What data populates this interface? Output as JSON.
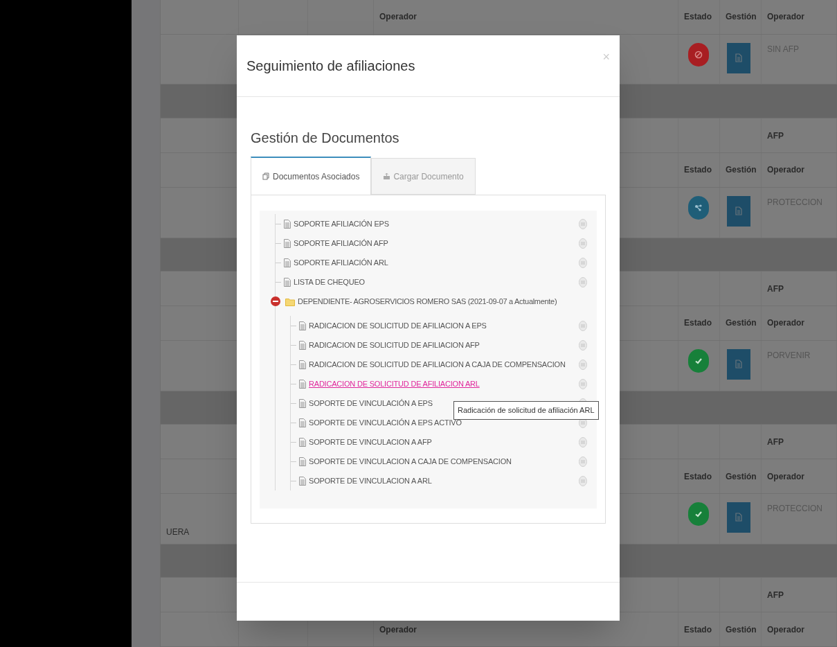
{
  "background_table": {
    "rows": [
      {
        "kind": "header",
        "middle_label": "Operador",
        "columns": [
          "Estado",
          "Gestión",
          "Operador"
        ]
      },
      {
        "kind": "data",
        "status": {
          "kind": "blocked",
          "color": "#a81e22"
        },
        "operator": "SIN AFP"
      },
      {
        "kind": "band"
      },
      {
        "kind": "type",
        "label": "AFP"
      },
      {
        "kind": "header",
        "columns": [
          "Estado",
          "Gestión",
          "Operador"
        ]
      },
      {
        "kind": "data",
        "status": {
          "kind": "network",
          "color": "#1f5e78"
        },
        "operator": "PROTECCION"
      },
      {
        "kind": "band"
      },
      {
        "kind": "type",
        "label": "AFP"
      },
      {
        "kind": "header",
        "columns": [
          "Estado",
          "Gestión",
          "Operador"
        ]
      },
      {
        "kind": "data",
        "status": {
          "kind": "check",
          "color": "#17803a"
        },
        "operator": "PORVENIR"
      },
      {
        "kind": "band"
      },
      {
        "kind": "type",
        "label": "AFP"
      },
      {
        "kind": "header",
        "columns": [
          "Estado",
          "Gestión",
          "Operador"
        ]
      },
      {
        "kind": "data",
        "status": {
          "kind": "check",
          "color": "#17803a"
        },
        "operator": "PROTECCION",
        "left_text": "UERA"
      },
      {
        "kind": "band"
      },
      {
        "kind": "type",
        "label": "AFP"
      },
      {
        "kind": "header",
        "middle_label": "Operador",
        "columns": [
          "Estado",
          "Gestión",
          "Operador"
        ]
      }
    ]
  },
  "modal": {
    "title": "Seguimiento de afiliaciones",
    "close": "×",
    "heading": "Gestión de Documentos",
    "tabs": [
      {
        "label": "Documentos Asociados",
        "selected": true
      },
      {
        "label": "Cargar Documento",
        "selected": false
      }
    ],
    "tree": [
      {
        "kind": "file",
        "label": "SOPORTE AFILIACIÓN EPS",
        "hovered": false
      },
      {
        "kind": "file",
        "label": "SOPORTE AFILIACIÓN AFP",
        "hovered": false
      },
      {
        "kind": "file",
        "label": "SOPORTE AFILIACIÓN ARL",
        "hovered": false
      },
      {
        "kind": "file",
        "label": "LISTA DE CHEQUEO",
        "hovered": false
      },
      {
        "kind": "folder",
        "label": "DEPENDIENTE- AGROSERVICIOS ROMERO SAS (2021-09-07 a Actualmente)",
        "expanded": true,
        "children": [
          {
            "kind": "file",
            "label": "RADICACION DE SOLICITUD DE AFILIACION A EPS",
            "hovered": false
          },
          {
            "kind": "file",
            "label": "RADICACION DE SOLICITUD DE AFILIACION AFP",
            "hovered": false
          },
          {
            "kind": "file",
            "label": "RADICACION DE SOLICITUD DE AFILIACION A CAJA DE COMPENSACION",
            "hovered": false
          },
          {
            "kind": "file",
            "label": "RADICACION DE SOLICITUD DE AFILIACION ARL",
            "hovered": true
          },
          {
            "kind": "file",
            "label": "SOPORTE DE VINCULACIÓN A EPS",
            "hovered": false
          },
          {
            "kind": "file",
            "label": "SOPORTE DE VINCULACIÓN A EPS ACTIVO",
            "hovered": false
          },
          {
            "kind": "file",
            "label": "SOPORTE DE VINCULACION A AFP",
            "hovered": false
          },
          {
            "kind": "file",
            "label": "SOPORTE DE VINCULACION A CAJA DE COMPENSACION",
            "hovered": false
          },
          {
            "kind": "file",
            "label": "SOPORTE DE VINCULACION A ARL",
            "hovered": false
          }
        ]
      }
    ],
    "tooltip": "Radicación de solicitud de afiliación ARL"
  }
}
